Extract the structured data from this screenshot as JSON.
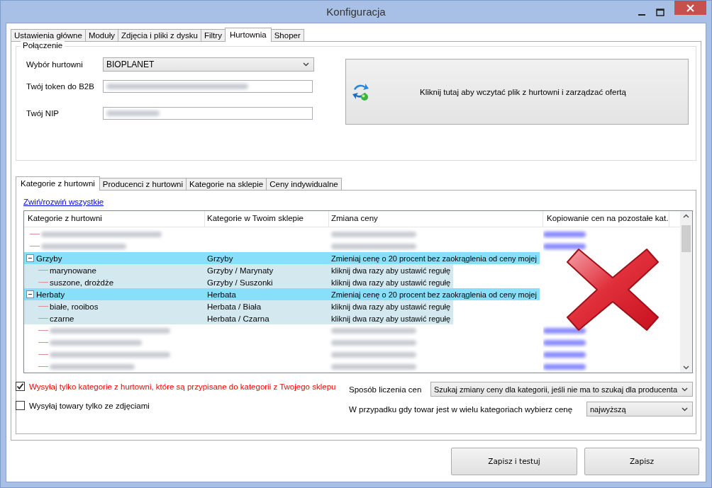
{
  "window": {
    "title": "Konfiguracja"
  },
  "tabs": [
    {
      "label": "Ustawienia główne",
      "selected": false
    },
    {
      "label": "Moduły",
      "selected": false
    },
    {
      "label": "Zdjęcia i pliki z dysku",
      "selected": false
    },
    {
      "label": "Filtry",
      "selected": false
    },
    {
      "label": "Hurtownia",
      "selected": true
    },
    {
      "label": "Shoper",
      "selected": false
    }
  ],
  "connection": {
    "title": "Połączenie",
    "wholesaler_label": "Wybór hurtowni",
    "wholesaler_value": "BIOPLANET",
    "token_label": "Twój token do B2B",
    "nip_label": "Twój NIP",
    "load_button": "Kliknij tutaj aby wczytać plik z hurtowni i zarządzać ofertą"
  },
  "subtabs": [
    {
      "label": "Kategorie z hurtowni",
      "selected": true
    },
    {
      "label": "Producenci z hurtowni",
      "selected": false
    },
    {
      "label": "Kategorie na sklepie",
      "selected": false
    },
    {
      "label": "Ceny indywidualne",
      "selected": false
    }
  ],
  "tree": {
    "link": "Zwiń/rozwiń wszystkie",
    "columns": [
      "Kategorie z hurtowni",
      "Kategorie w Twoim sklepie",
      "Zmiana ceny",
      "Kopiowanie cen na pozostałe kat."
    ],
    "rows": [
      {
        "kind": "blurred"
      },
      {
        "kind": "blurred"
      },
      {
        "kind": "category",
        "name": "Grzyby",
        "shop": "Grzyby",
        "price": "Zmieniaj cenę o 20 procent bez zaokrąglenia od ceny mojej",
        "expanded": true,
        "children": [
          {
            "name": "marynowane",
            "shop": "Grzyby / Marynaty",
            "price": "kliknij dwa razy aby ustawić regułę"
          },
          {
            "name": "suszone, drożdże",
            "shop": "Grzyby / Suszonki",
            "price": "kliknij dwa razy aby ustawić regułę"
          }
        ]
      },
      {
        "kind": "category",
        "name": "Herbaty",
        "shop": "Herbata",
        "price": "Zmieniaj cenę o 20 procent bez zaokrąglenia od ceny mojej",
        "expanded": true,
        "children": [
          {
            "name": "białe, rooibos",
            "shop": "Herbata / Biała",
            "price": "kliknij dwa razy aby ustawić regułę"
          },
          {
            "name": "czarne",
            "shop": "Herbata / Czarna",
            "price": "kliknij dwa razy aby ustawić regułę"
          }
        ]
      },
      {
        "kind": "blurred-child"
      },
      {
        "kind": "blurred-child"
      },
      {
        "kind": "blurred-child"
      },
      {
        "kind": "blurred-child"
      }
    ]
  },
  "options": [
    {
      "label": "Wysyłaj tylko kategorie z hurtowni, które są przypisane do kategorii z Twojego sklepu",
      "checked": true,
      "warning": true
    },
    {
      "label": "Wysyłaj towary tylko ze zdjęciami",
      "checked": false,
      "warning": false
    }
  ],
  "selects": [
    {
      "label": "Sposób liczenia cen",
      "value": "Szukaj zmiany ceny dla kategorii, jeśli nie ma to szukaj dla producenta",
      "kind": "wide"
    },
    {
      "label": "W przypadku gdy towar jest w wielu kategoriach wybierz cenę",
      "value": "najwyższą",
      "kind": "narrow"
    }
  ],
  "buttons": [
    "Zapisz i testuj",
    "Zapisz"
  ]
}
